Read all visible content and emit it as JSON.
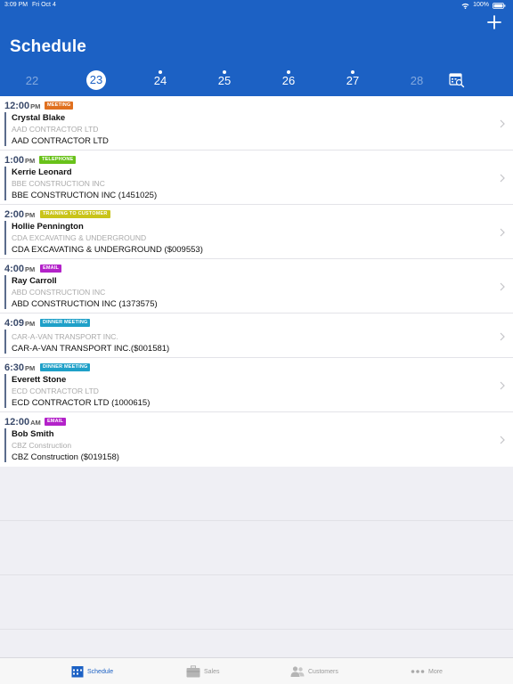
{
  "status_bar": {
    "time": "3:09 PM",
    "date": "Fri Oct 4",
    "battery": "100%"
  },
  "header": {
    "title": "Schedule"
  },
  "date_strip": [
    {
      "label": "22",
      "dot": false,
      "state": "dim"
    },
    {
      "label": "23",
      "dot": false,
      "state": "selected"
    },
    {
      "label": "24",
      "dot": true,
      "state": "normal"
    },
    {
      "label": "25",
      "dot": true,
      "state": "normal"
    },
    {
      "label": "26",
      "dot": true,
      "state": "normal"
    },
    {
      "label": "27",
      "dot": true,
      "state": "normal"
    },
    {
      "label": "28",
      "dot": false,
      "state": "dim"
    }
  ],
  "colors": {
    "brand": "#1c61c4",
    "meeting": "#e0701f",
    "telephone": "#69c21a",
    "training": "#c9c41a",
    "email": "#b322c9",
    "dinner_meeting": "#1fa0c8"
  },
  "appointments": [
    {
      "time": "12:00",
      "ampm": "PM",
      "type": "MEETING",
      "name": "Crystal Blake",
      "company": "AAD CONTRACTOR LTD",
      "account": "AAD CONTRACTOR LTD"
    },
    {
      "time": "1:00",
      "ampm": "PM",
      "type": "TELEPHONE",
      "name": "Kerrie Leonard",
      "company": "BBE CONSTRUCTION INC",
      "account": "BBE CONSTRUCTION INC (1451025)"
    },
    {
      "time": "2:00",
      "ampm": "PM",
      "type": "TRAINING TO CUSTOMER",
      "name": "Hollie Pennington",
      "company": "CDA EXCAVATING & UNDERGROUND",
      "account": "CDA EXCAVATING & UNDERGROUND ($009553)"
    },
    {
      "time": "4:00",
      "ampm": "PM",
      "type": "EMAIL",
      "name": "Ray Carroll",
      "company": "ABD CONSTRUCTION INC",
      "account": "ABD CONSTRUCTION INC (1373575)"
    },
    {
      "time": "4:09",
      "ampm": "PM",
      "type": "DINNER MEETING",
      "name": "",
      "company": "CAR-A-VAN TRANSPORT INC.",
      "account": "CAR-A-VAN TRANSPORT INC.($001581)"
    },
    {
      "time": "6:30",
      "ampm": "PM",
      "type": "DINNER MEETING",
      "name": "Everett Stone",
      "company": "ECD CONTRACTOR LTD",
      "account": "ECD CONTRACTOR LTD (1000615)"
    },
    {
      "time": "12:00",
      "ampm": "AM",
      "type": "EMAIL",
      "name": "Bob Smith",
      "company": "CBZ Construction",
      "account": "CBZ Construction ($019158)"
    }
  ],
  "tab_bar": {
    "tabs": [
      {
        "label": "Schedule",
        "icon": "calendar-icon",
        "active": true
      },
      {
        "label": "Sales",
        "icon": "briefcase-icon",
        "active": false
      },
      {
        "label": "Customers",
        "icon": "people-icon",
        "active": false
      },
      {
        "label": "More",
        "icon": "more-dots-icon",
        "active": false
      }
    ]
  }
}
